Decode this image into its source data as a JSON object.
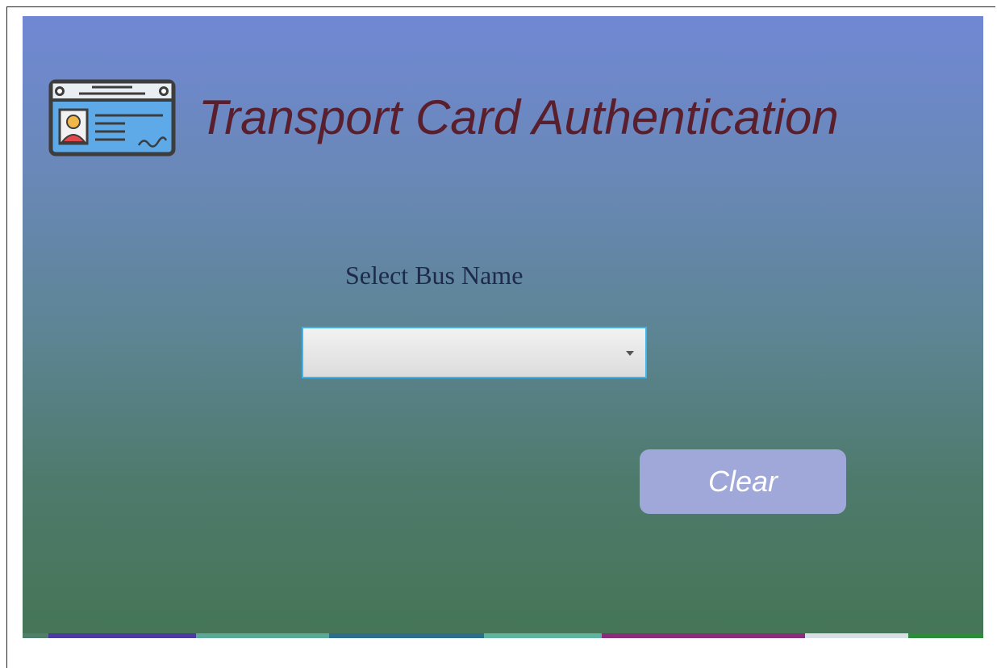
{
  "header": {
    "title": "Transport Card Authentication",
    "icon": "id-card-icon"
  },
  "form": {
    "select_label": "Select Bus Name",
    "bus_select": {
      "value": "",
      "icon": "chevron-down-icon"
    },
    "clear_label": "Clear"
  },
  "colors": {
    "title": "#5a1f2c",
    "label": "#1e2a4a",
    "button_bg": "#9fa8d8",
    "select_border": "#3fb2e8",
    "background_top": "#7088d4",
    "background_bottom": "#457556"
  },
  "bottom_strip": {
    "colors": [
      "#4f7f68",
      "#4b3aa0",
      "#5aa896",
      "#2c6e8a",
      "#5fb4a0",
      "#8a2e7c",
      "#d8dde6",
      "#2e8b3c"
    ]
  }
}
